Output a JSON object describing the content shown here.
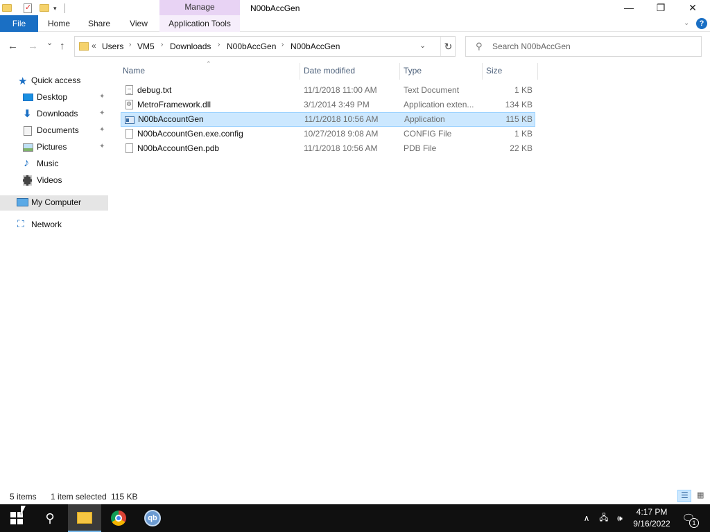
{
  "titlebar": {
    "contextual_tab_group": "Manage",
    "window_title": "N00bAccGen",
    "minimize_glyph": "—",
    "restore_glyph": "❐",
    "close_glyph": "✕"
  },
  "ribbon": {
    "tabs": [
      {
        "label": "File"
      },
      {
        "label": "Home"
      },
      {
        "label": "Share"
      },
      {
        "label": "View"
      },
      {
        "label": "Application Tools"
      }
    ],
    "help_glyph": "?"
  },
  "navigation": {
    "back_glyph": "←",
    "forward_glyph": "→",
    "recent_glyph": "⌄",
    "up_glyph": "↑"
  },
  "address_bar": {
    "overflow_glyph": "«",
    "breadcrumbs": [
      "Users",
      "VM5",
      "Downloads",
      "N00bAccGen",
      "N00bAccGen"
    ],
    "separator": "›",
    "refresh_glyph": "↻"
  },
  "search": {
    "placeholder": "Search N00bAccGen"
  },
  "nav_pane": {
    "items": [
      {
        "label": "Quick access",
        "icon": "star-icon",
        "color": "#1a6fc4"
      },
      {
        "label": "Desktop",
        "icon": "desktop-icon",
        "pinned": true
      },
      {
        "label": "Downloads",
        "icon": "download-icon",
        "pinned": true
      },
      {
        "label": "Documents",
        "icon": "document-icon",
        "pinned": true
      },
      {
        "label": "Pictures",
        "icon": "pictures-icon",
        "pinned": true
      },
      {
        "label": "Music",
        "icon": "music-icon"
      },
      {
        "label": "Videos",
        "icon": "video-icon"
      },
      {
        "label": "My Computer",
        "icon": "computer-icon",
        "selected": true
      },
      {
        "label": "Network",
        "icon": "network-icon"
      }
    ],
    "pin_glyph": "📌"
  },
  "file_list": {
    "columns": [
      "Name",
      "Date modified",
      "Type",
      "Size"
    ],
    "sorted_column": "Name",
    "rows": [
      {
        "name": "debug.txt",
        "date": "11/1/2018 11:00 AM",
        "type": "Text Document",
        "size": "1 KB",
        "icon": "text-file-icon"
      },
      {
        "name": "MetroFramework.dll",
        "date": "3/1/2014 3:49 PM",
        "type": "Application exten...",
        "size": "134 KB",
        "icon": "dll-file-icon"
      },
      {
        "name": "N00bAccountGen",
        "date": "11/1/2018 10:56 AM",
        "type": "Application",
        "size": "115 KB",
        "icon": "application-icon",
        "selected": true
      },
      {
        "name": "N00bAccountGen.exe.config",
        "date": "10/27/2018 9:08 AM",
        "type": "CONFIG File",
        "size": "1 KB",
        "icon": "blank-file-icon"
      },
      {
        "name": "N00bAccountGen.pdb",
        "date": "11/1/2018 10:56 AM",
        "type": "PDB File",
        "size": "22 KB",
        "icon": "blank-file-icon"
      }
    ]
  },
  "status_bar": {
    "item_count": "5 items",
    "selection": "1 item selected",
    "selection_size": "115 KB"
  },
  "taskbar": {
    "apps": [
      "file-explorer",
      "chrome",
      "qbittorrent"
    ],
    "qb_label": "qb",
    "tray_chevron": "∧",
    "clock_time": "4:17 PM",
    "clock_date": "9/16/2022",
    "notification_count": "1"
  },
  "colors": {
    "accent": "#1a6fc4",
    "selection_bg": "#cce8ff",
    "selection_border": "#99d1ff",
    "manage_band": "#e8d3f4",
    "taskbar": "#101010"
  }
}
